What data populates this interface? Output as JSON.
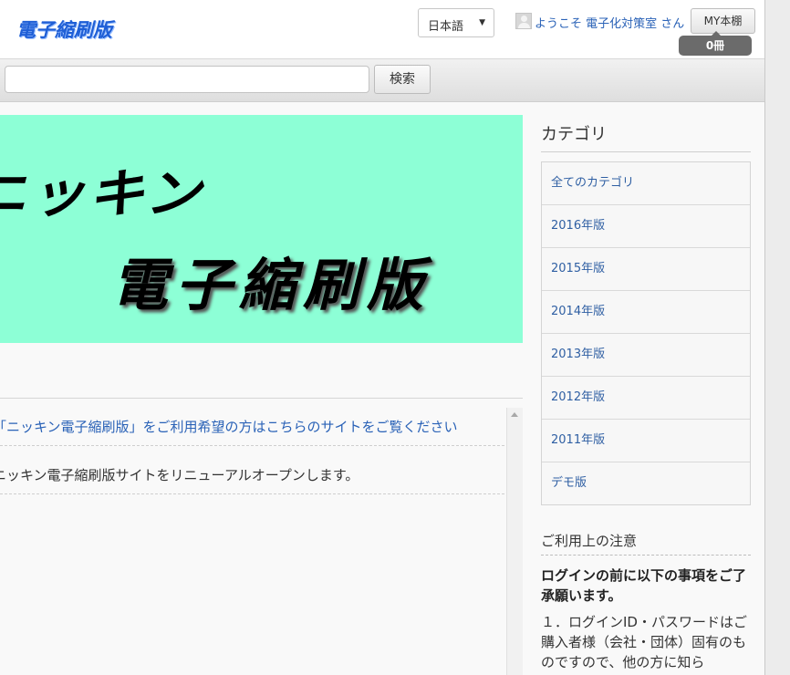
{
  "header": {
    "logo_text": "電子縮刷版",
    "language": {
      "selected": "日本語"
    },
    "welcome_text": "ようこそ 電子化対策室 さん",
    "mybook_label": "MY本棚",
    "mybook_count": "0冊"
  },
  "search": {
    "placeholder": "",
    "value": "",
    "button_label": "検索"
  },
  "banner": {
    "line1": "ニッキン",
    "line2": "電子縮刷版"
  },
  "news": {
    "items": [
      {
        "text": "「ニッキン電子縮刷版」をご利用希望の方はこちらのサイトをご覧ください",
        "is_link": true
      },
      {
        "text": "ニッキン電子縮刷版サイトをリニューアルオープンします。",
        "is_link": false
      }
    ]
  },
  "sidebar": {
    "title": "カテゴリ",
    "categories": [
      {
        "label": "全てのカテゴリ"
      },
      {
        "label": "2016年版"
      },
      {
        "label": "2015年版"
      },
      {
        "label": "2014年版"
      },
      {
        "label": "2013年版"
      },
      {
        "label": "2012年版"
      },
      {
        "label": "2011年版"
      },
      {
        "label": "デモ版"
      }
    ],
    "notice": {
      "title": "ご利用上の注意",
      "bold": "ログインの前に以下の事項をご了承願います。",
      "body": "１．ログインID・パスワードはご購入者様（会社・団体）固有のものですので、他の方に知ら"
    }
  },
  "colors": {
    "link": "#2a62b7",
    "banner_bg": "#8dffd6",
    "logo": "#1f5fd6",
    "count_badge": "#6b6b6b"
  }
}
